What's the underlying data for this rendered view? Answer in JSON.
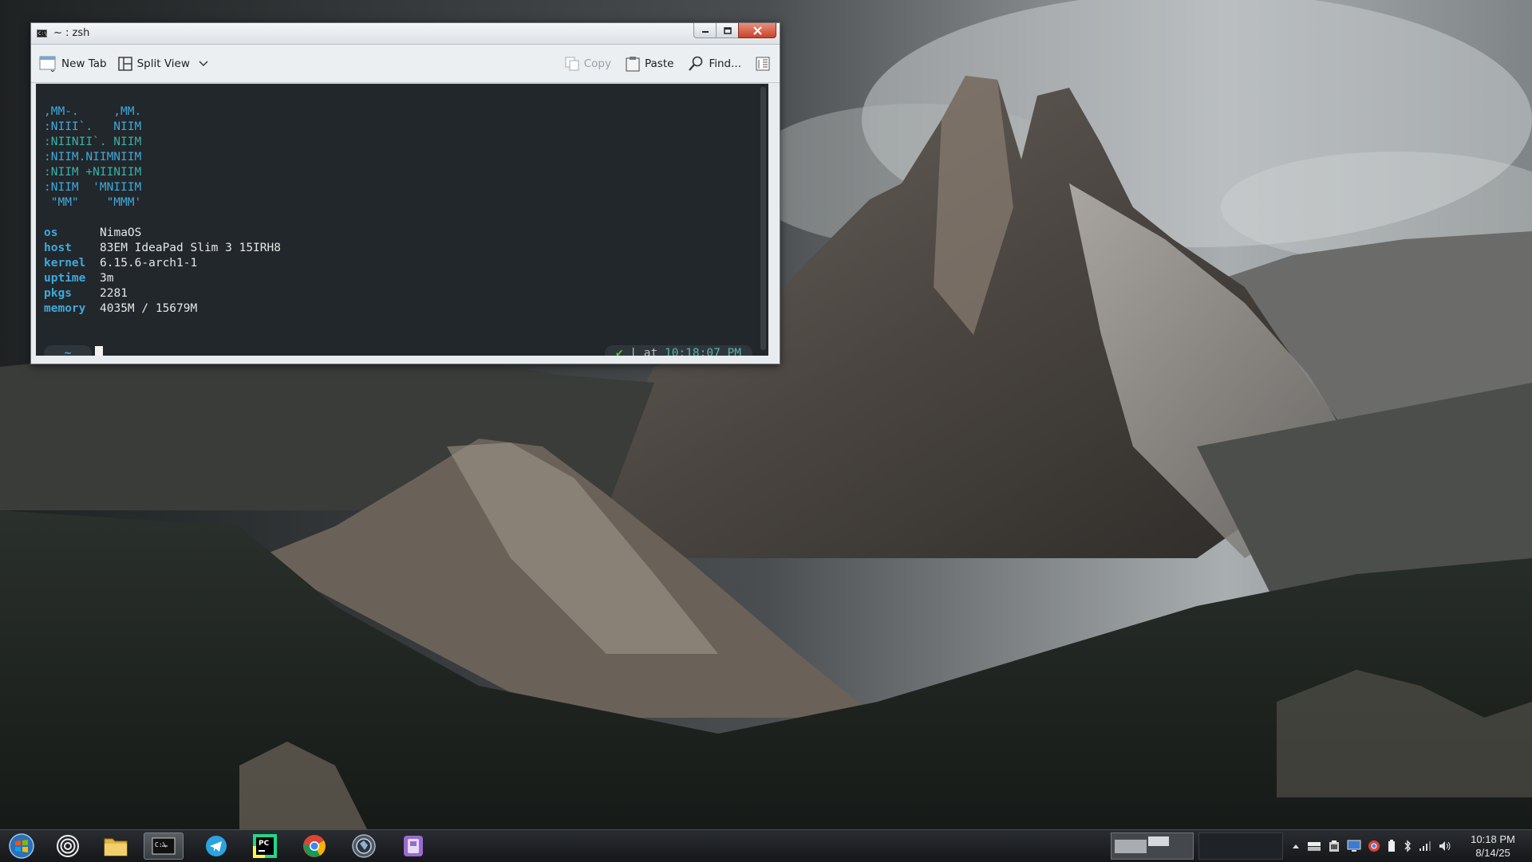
{
  "window": {
    "title": "~ : zsh",
    "controls": {
      "minimize": "minimize-icon",
      "maximize": "maximize-icon",
      "close": "close-icon"
    }
  },
  "toolbar": {
    "new_tab": "New Tab",
    "split_view": "Split View",
    "copy": "Copy",
    "paste": "Paste",
    "find": "Find..."
  },
  "terminal": {
    "ascii_logo": [
      ",MM-.     ,MM.",
      ":NIII`.   NIIM",
      ":NIINII`. NIIM",
      ":NIIM.NIIMNIIM",
      ":NIIM +NIINIIM",
      ":NIIM  'MNIIIM",
      " \"MM\"    \"MMM'"
    ],
    "info": [
      {
        "key": "os",
        "value": "NimaOS"
      },
      {
        "key": "host",
        "value": "83EM IdeaPad Slim 3 15IRH8"
      },
      {
        "key": "kernel",
        "value": "6.15.6-arch1-1"
      },
      {
        "key": "uptime",
        "value": "3m"
      },
      {
        "key": "pkgs",
        "value": "2281"
      },
      {
        "key": "memory",
        "value": "4035M / 15679M"
      }
    ],
    "prompt": {
      "dir": "~",
      "status_icon": "✔",
      "at_label": "at",
      "time": "10:18:07 PM"
    }
  },
  "taskbar": {
    "apps": [
      {
        "name": "start-menu",
        "icon": "windows-orb-icon"
      },
      {
        "name": "activities",
        "icon": "spiral-icon"
      },
      {
        "name": "file-manager",
        "icon": "folder-icon"
      },
      {
        "name": "terminal",
        "icon": "terminal-icon",
        "active": true
      },
      {
        "name": "telegram",
        "icon": "telegram-icon"
      },
      {
        "name": "pycharm",
        "icon": "pycharm-icon"
      },
      {
        "name": "chrome",
        "icon": "chrome-icon"
      },
      {
        "name": "app-globe",
        "icon": "globe-icon"
      },
      {
        "name": "app-purple",
        "icon": "purple-app-icon"
      }
    ],
    "clock": {
      "time": "10:18 PM",
      "date": "8/14/25"
    }
  }
}
